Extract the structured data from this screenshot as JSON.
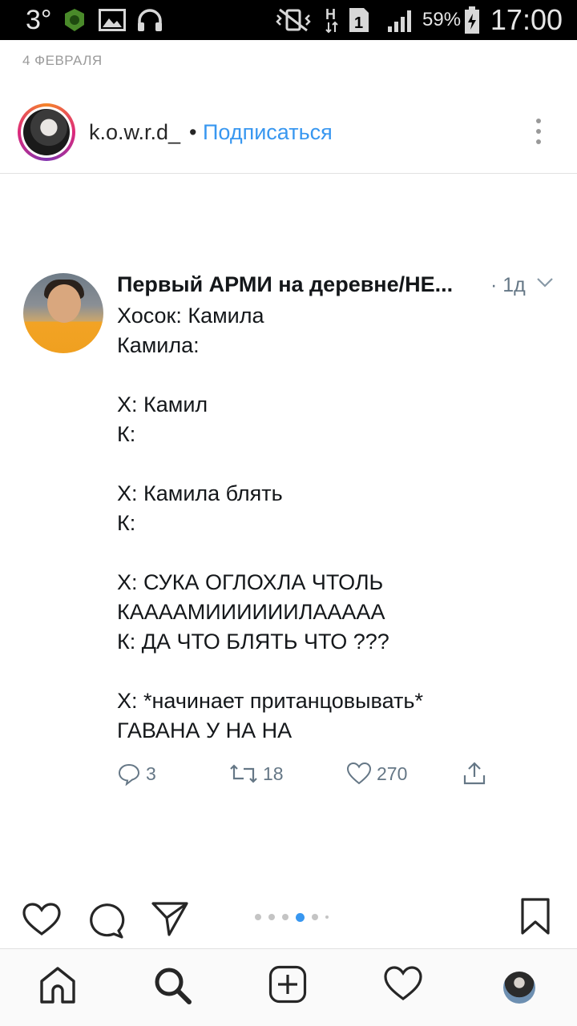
{
  "status_bar": {
    "temperature": "3°",
    "battery_percent": "59%",
    "time": "17:00",
    "icons": [
      "weather-app-icon",
      "image-icon",
      "headphones-icon",
      "vibrate-icon",
      "network-h-icon",
      "sim-1-icon",
      "signal-icon",
      "battery-charging-icon"
    ]
  },
  "post": {
    "date": "4 ФЕВРАЛЯ",
    "username": "k.o.w.r.d_",
    "separator": "•",
    "follow_label": "Подписаться"
  },
  "tweet": {
    "author_name": "Первый АРМИ на деревне/НЕ...",
    "time_ago": "· 1д",
    "lines": [
      "Хосок: Камила",
      "Камила:",
      "",
      "Х: Камил",
      "К:",
      "",
      "Х: Камила блять",
      "К:",
      "",
      "Х: СУКА ОГЛОХЛА ЧТОЛЬ",
      "КААААМИИИИИИЛААААА",
      "К: ДА ЧТО БЛЯТЬ ЧТО ???",
      "",
      "Х: *начинает пританцовывать*",
      "ГАВАНА У НА НА"
    ],
    "replies": "3",
    "retweets": "18",
    "likes": "270"
  },
  "carousel": {
    "active_index": 3,
    "count": 6
  },
  "colors": {
    "follow_blue": "#3897f0",
    "carousel_active": "#3897f0",
    "tweet_gray": "#657786"
  }
}
